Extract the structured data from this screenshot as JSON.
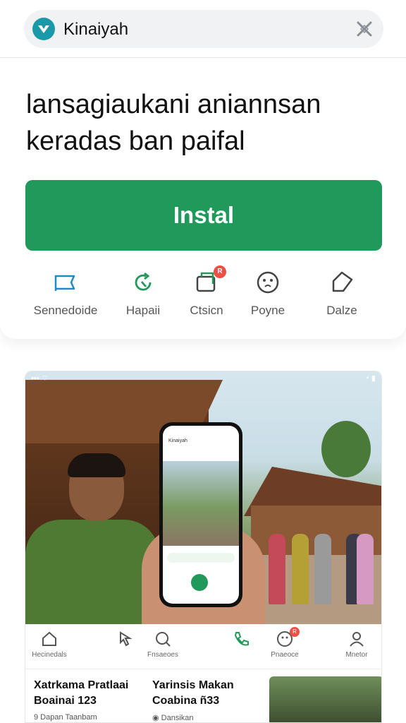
{
  "header": {
    "app_name": "Kinaiyah",
    "close_icon": "close-icon",
    "logo_color": "#1a9aa8"
  },
  "card": {
    "headline_line1": "lansagiaukani aniannsan",
    "headline_line2": "keradas ban paifal",
    "install_label": "Instal",
    "accent": "#21995a",
    "actions": [
      {
        "label": "Sennedoide",
        "icon": "flag-icon"
      },
      {
        "label": "Hapaii",
        "icon": "refresh-icon"
      },
      {
        "label": "Ctsicn",
        "icon": "folder-icon",
        "badge": "R"
      },
      {
        "label": "Poyne",
        "icon": "smiley-icon"
      },
      {
        "label": "Dalze",
        "icon": "tag-icon"
      }
    ]
  },
  "screenshot": {
    "status_left": "•••  ⌔",
    "status_right": "◔ ▮",
    "phone_title": "Kinaiyah",
    "nav": [
      {
        "label": "Hecinedals",
        "icon": "home-icon"
      },
      {
        "label": "",
        "icon": "pointer-icon"
      },
      {
        "label": "Fnsaeoes",
        "icon": "search-icon"
      },
      {
        "label": "",
        "icon": "phone-icon"
      },
      {
        "label": "Pnaeoce",
        "icon": "smiley-icon",
        "badge": "R"
      },
      {
        "label": "Mnetor",
        "icon": "user-icon"
      }
    ],
    "cards": [
      {
        "title": "Xatrkama Pratlaai Boainai 123",
        "subtitle": "9 Dapan  Taanbam"
      },
      {
        "title": "Yarinsis Makan Coabina ñ33",
        "subtitle": "◉ Dansikan"
      }
    ]
  }
}
